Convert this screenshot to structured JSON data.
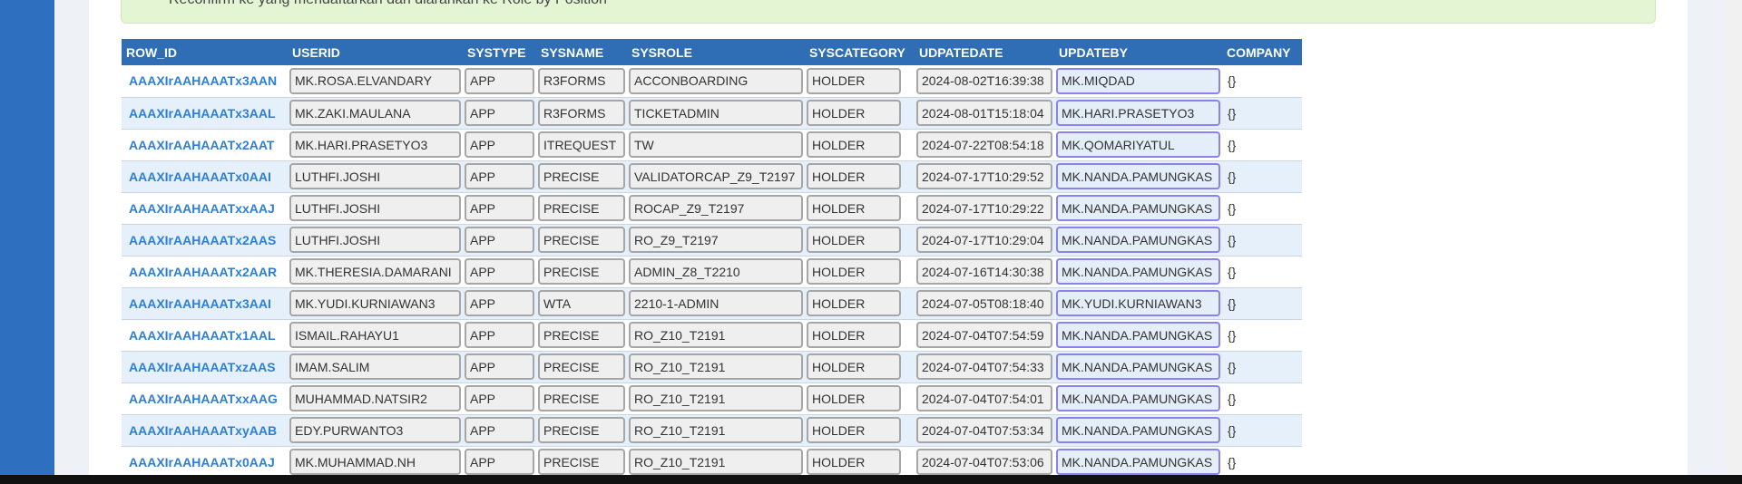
{
  "notice": {
    "text": "Reconfirm ke yang mendaftarkan dan diarahkan ke Role by Position"
  },
  "table": {
    "columns": [
      "ROW_ID",
      "USERID",
      "SYSTYPE",
      "SYSNAME",
      "SYSROLE",
      "SYSCATEGORY",
      "UDPATEDATE",
      "UPDATEBY",
      "COMPANY"
    ],
    "rows": [
      {
        "row_id": "AAAXIrAAHAAATx3AAN",
        "userid": "MK.ROSA.ELVANDARY",
        "systype": "APP",
        "sysname": "R3FORMS",
        "sysrole": "ACCONBOARDING",
        "syscategory": "HOLDER",
        "updatedate": "2024-08-02T16:39:38",
        "updateby": "MK.MIQDAD",
        "company": "{}"
      },
      {
        "row_id": "AAAXIrAAHAAATx3AAL",
        "userid": "MK.ZAKI.MAULANA",
        "systype": "APP",
        "sysname": "R3FORMS",
        "sysrole": "TICKETADMIN",
        "syscategory": "HOLDER",
        "updatedate": "2024-08-01T15:18:04",
        "updateby": "MK.HARI.PRASETYO3",
        "company": "{}"
      },
      {
        "row_id": "AAAXIrAAHAAATx2AAT",
        "userid": "MK.HARI.PRASETYO3",
        "systype": "APP",
        "sysname": "ITREQUEST",
        "sysrole": "TW",
        "syscategory": "HOLDER",
        "updatedate": "2024-07-22T08:54:18",
        "updateby": "MK.QOMARIYATUL",
        "company": "{}"
      },
      {
        "row_id": "AAAXIrAAHAAATx0AAI",
        "userid": "LUTHFI.JOSHI",
        "systype": "APP",
        "sysname": "PRECISE",
        "sysrole": "VALIDATORCAP_Z9_T2197",
        "syscategory": "HOLDER",
        "updatedate": "2024-07-17T10:29:52",
        "updateby": "MK.NANDA.PAMUNGKAS",
        "company": "{}"
      },
      {
        "row_id": "AAAXIrAAHAAATxxAAJ",
        "userid": "LUTHFI.JOSHI",
        "systype": "APP",
        "sysname": "PRECISE",
        "sysrole": "ROCAP_Z9_T2197",
        "syscategory": "HOLDER",
        "updatedate": "2024-07-17T10:29:22",
        "updateby": "MK.NANDA.PAMUNGKAS",
        "company": "{}"
      },
      {
        "row_id": "AAAXIrAAHAAATx2AAS",
        "userid": "LUTHFI.JOSHI",
        "systype": "APP",
        "sysname": "PRECISE",
        "sysrole": "RO_Z9_T2197",
        "syscategory": "HOLDER",
        "updatedate": "2024-07-17T10:29:04",
        "updateby": "MK.NANDA.PAMUNGKAS",
        "company": "{}"
      },
      {
        "row_id": "AAAXIrAAHAAATx2AAR",
        "userid": "MK.THERESIA.DAMARANI",
        "systype": "APP",
        "sysname": "PRECISE",
        "sysrole": "ADMIN_Z8_T2210",
        "syscategory": "HOLDER",
        "updatedate": "2024-07-16T14:30:38",
        "updateby": "MK.NANDA.PAMUNGKAS",
        "company": "{}"
      },
      {
        "row_id": "AAAXIrAAHAAATx3AAI",
        "userid": "MK.YUDI.KURNIAWAN3",
        "systype": "APP",
        "sysname": "WTA",
        "sysrole": "2210-1-ADMIN",
        "syscategory": "HOLDER",
        "updatedate": "2024-07-05T08:18:40",
        "updateby": "MK.YUDI.KURNIAWAN3",
        "company": "{}"
      },
      {
        "row_id": "AAAXIrAAHAAATx1AAL",
        "userid": "ISMAIL.RAHAYU1",
        "systype": "APP",
        "sysname": "PRECISE",
        "sysrole": "RO_Z10_T2191",
        "syscategory": "HOLDER",
        "updatedate": "2024-07-04T07:54:59",
        "updateby": "MK.NANDA.PAMUNGKAS",
        "company": "{}"
      },
      {
        "row_id": "AAAXIrAAHAAATxzAAS",
        "userid": "IMAM.SALIM",
        "systype": "APP",
        "sysname": "PRECISE",
        "sysrole": "RO_Z10_T2191",
        "syscategory": "HOLDER",
        "updatedate": "2024-07-04T07:54:33",
        "updateby": "MK.NANDA.PAMUNGKAS",
        "company": "{}"
      },
      {
        "row_id": "AAAXIrAAHAAATxxAAG",
        "userid": "MUHAMMAD.NATSIR2",
        "systype": "APP",
        "sysname": "PRECISE",
        "sysrole": "RO_Z10_T2191",
        "syscategory": "HOLDER",
        "updatedate": "2024-07-04T07:54:01",
        "updateby": "MK.NANDA.PAMUNGKAS",
        "company": "{}"
      },
      {
        "row_id": "AAAXIrAAHAAATxyAAB",
        "userid": "EDY.PURWANTO3",
        "systype": "APP",
        "sysname": "PRECISE",
        "sysrole": "RO_Z10_T2191",
        "syscategory": "HOLDER",
        "updatedate": "2024-07-04T07:53:34",
        "updateby": "MK.NANDA.PAMUNGKAS",
        "company": "{}"
      },
      {
        "row_id": "AAAXIrAAHAAATx0AAJ",
        "userid": "MK.MUHAMMAD.NH",
        "systype": "APP",
        "sysname": "PRECISE",
        "sysrole": "RO_Z10_T2191",
        "syscategory": "HOLDER",
        "updatedate": "2024-07-04T07:53:06",
        "updateby": "MK.NANDA.PAMUNGKAS",
        "company": "{}"
      }
    ]
  },
  "colors": {
    "header_bg": "#2f6db5",
    "link": "#2d7fd3",
    "alt_row": "#e6f0fa",
    "notice_bg": "#e3f5d3",
    "highlight_border": "#8b82ee"
  }
}
